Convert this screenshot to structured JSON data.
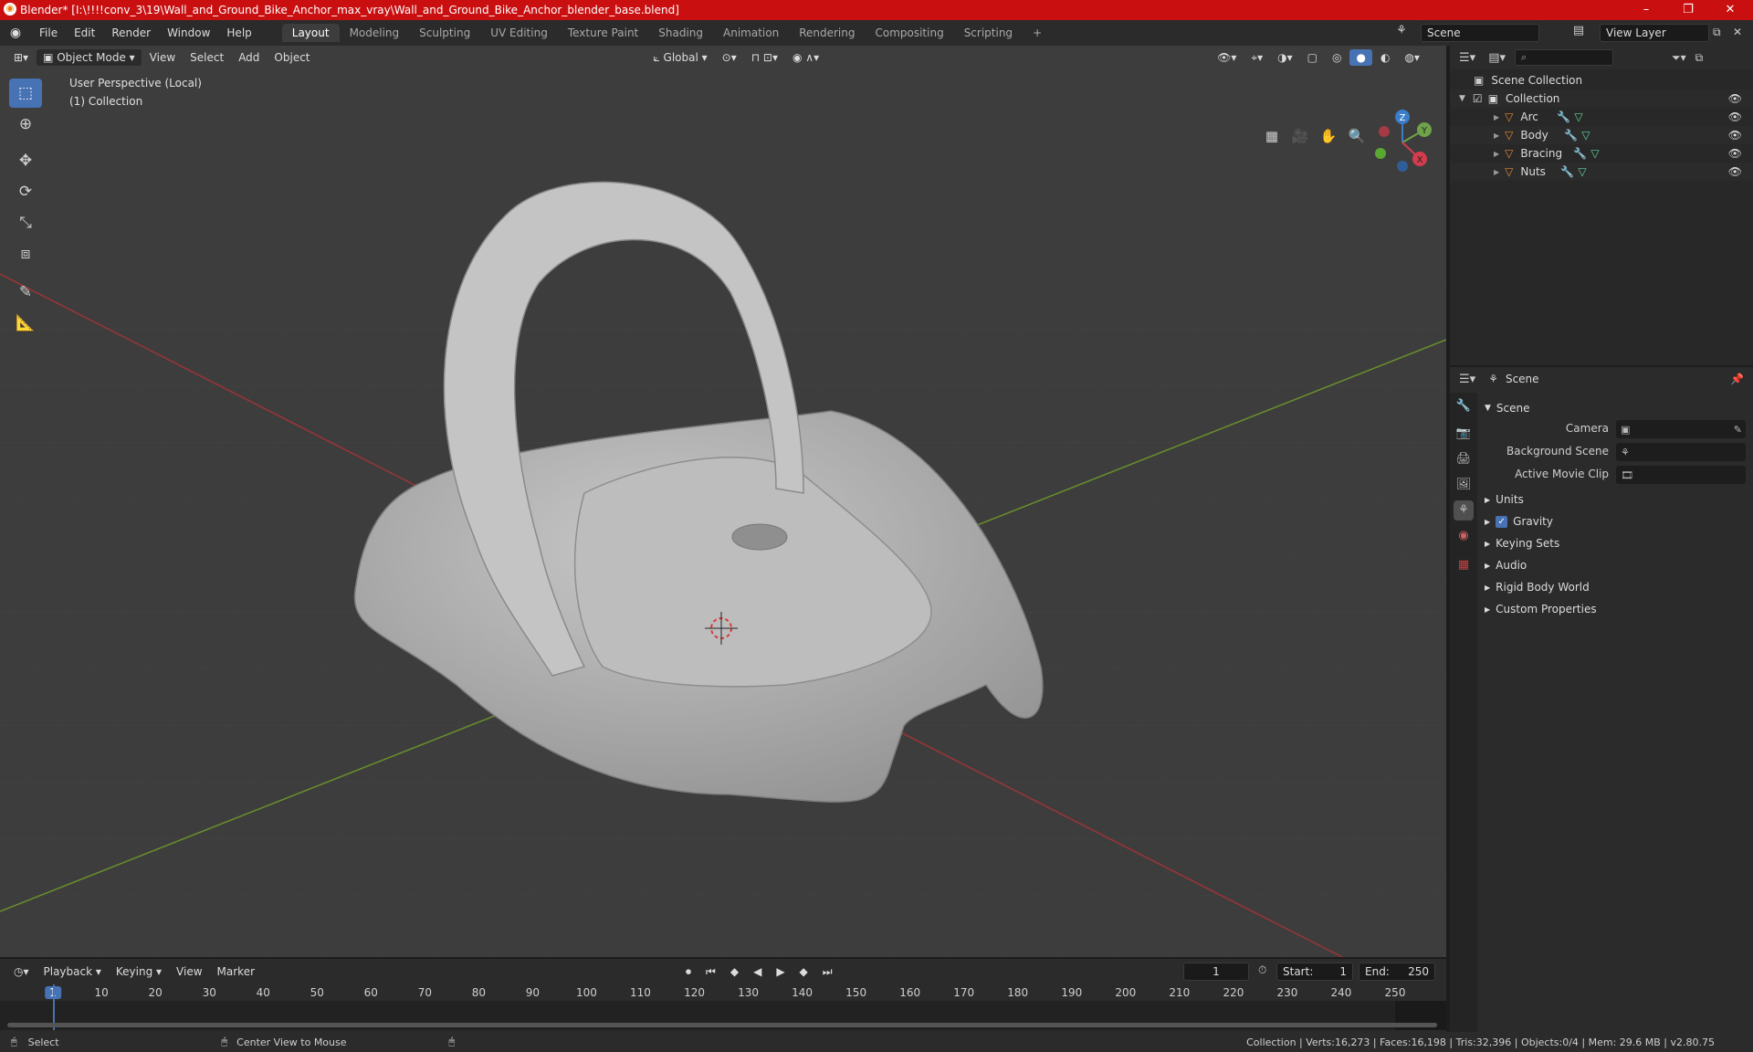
{
  "window": {
    "title": "Blender* [I:\\!!!!conv_3\\19\\Wall_and_Ground_Bike_Anchor_max_vray\\Wall_and_Ground_Bike_Anchor_blender_base.blend]",
    "minimize": "–",
    "maximize": "❐",
    "close": "✕"
  },
  "menubar": {
    "menus": [
      "File",
      "Edit",
      "Render",
      "Window",
      "Help"
    ],
    "workspaces": [
      "Layout",
      "Modeling",
      "Sculpting",
      "UV Editing",
      "Texture Paint",
      "Shading",
      "Animation",
      "Rendering",
      "Compositing",
      "Scripting"
    ],
    "active_workspace": "Layout",
    "add_tab": "+",
    "scene_name": "Scene",
    "view_layer": "View Layer"
  },
  "viewport": {
    "mode": "Object Mode",
    "menus": [
      "View",
      "Select",
      "Add",
      "Object"
    ],
    "orientation": "Global",
    "overlay_line1": "User Perspective (Local)",
    "overlay_line2": "(1) Collection",
    "gizmo_axes": {
      "z": "Z",
      "y": "Y",
      "x": "X"
    }
  },
  "outliner": {
    "root": "Scene Collection",
    "collection": "Collection",
    "objects": [
      "Arc",
      "Body",
      "Bracing",
      "Nuts"
    ]
  },
  "properties": {
    "context": "Scene",
    "section": "Scene",
    "fields": [
      {
        "label": "Camera",
        "value": ""
      },
      {
        "label": "Background Scene",
        "value": ""
      },
      {
        "label": "Active Movie Clip",
        "value": ""
      }
    ],
    "panels": [
      "Units",
      "Gravity",
      "Keying Sets",
      "Audio",
      "Rigid Body World",
      "Custom Properties"
    ],
    "gravity_checked": true
  },
  "timeline": {
    "menus": [
      "Playback",
      "Keying",
      "View",
      "Marker"
    ],
    "current_frame": "1",
    "start_label": "Start:",
    "start": "1",
    "end_label": "End:",
    "end": "250",
    "ticks": [
      "1",
      "10",
      "20",
      "30",
      "40",
      "50",
      "60",
      "70",
      "80",
      "90",
      "100",
      "110",
      "120",
      "130",
      "140",
      "150",
      "160",
      "170",
      "180",
      "190",
      "200",
      "210",
      "220",
      "230",
      "240",
      "250"
    ]
  },
  "statusbar": {
    "select": "Select",
    "center_view": "Center View to Mouse",
    "stats": "Collection | Verts:16,273 | Faces:16,198 | Tris:32,396 | Objects:0/4 | Mem: 29.6 MB | v2.80.75"
  },
  "colors": {
    "titlebar": "#c90f10",
    "accent": "#4772b3",
    "object_icon": "#e38a2e",
    "modifier_icon": "#6fa8dc",
    "mesh_icon": "#5fd5a0"
  }
}
